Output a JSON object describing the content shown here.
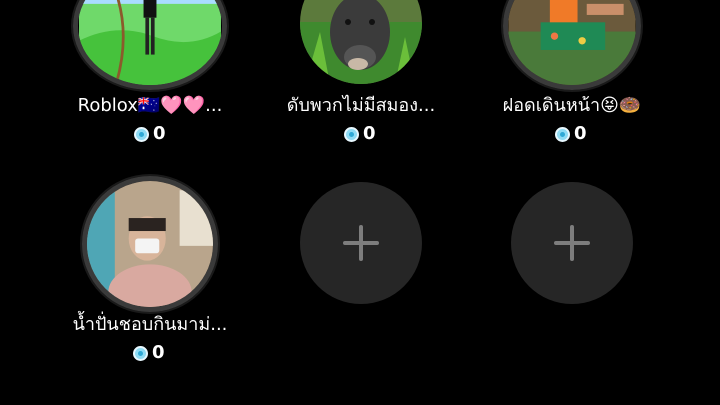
{
  "slots": [
    {
      "name": "Roblox🇦🇺🩷🩷...",
      "coins": "0"
    },
    {
      "name": "ดับพวกไม่มีสมอง...",
      "coins": "0"
    },
    {
      "name": "ฝอดเดินหน้า😝🍩",
      "coins": "0"
    },
    {
      "name": "น้ำปั่นชอบกินมาม่...",
      "coins": "0"
    }
  ],
  "empty_slots": 2,
  "colors": {
    "background": "#000000",
    "slot_bg": "#262626",
    "plus": "#7d7d7d",
    "coin": "#8fdcf5"
  }
}
